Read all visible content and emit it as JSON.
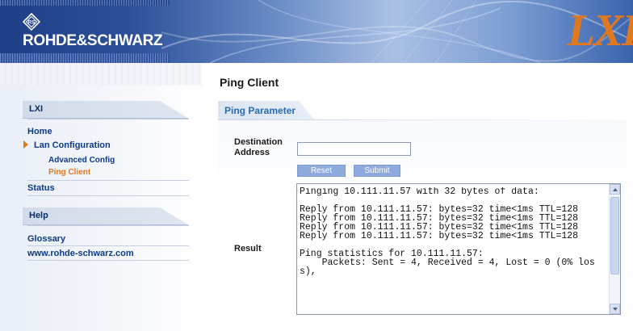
{
  "header": {
    "brand": "ROHDE&SCHWARZ",
    "brand_mark": "LXI",
    "accent_color": "#e07820",
    "banner_color": "#2a4f98"
  },
  "sidebar": {
    "sections": [
      {
        "title": "LXI",
        "items": [
          {
            "label": "Home",
            "level": 1,
            "active": false
          },
          {
            "label": "Lan Configuration",
            "level": 1,
            "active": false,
            "expanded": true
          },
          {
            "label": "Advanced Config",
            "level": 2,
            "active": false
          },
          {
            "label": "Ping Client",
            "level": 2,
            "active": true
          },
          {
            "label": "Status",
            "level": 1,
            "active": false
          }
        ]
      },
      {
        "title": "Help",
        "items": [
          {
            "label": "Glossary",
            "level": 1,
            "active": false
          },
          {
            "label": "www.rohde-schwarz.com",
            "level": 1,
            "active": false
          }
        ]
      }
    ]
  },
  "main": {
    "title": "Ping Client",
    "section_title": "Ping Parameter",
    "destination": {
      "label_line1": "Destination",
      "label_line2": "Address",
      "value": ""
    },
    "buttons": {
      "reset": "Reset",
      "submit": "Submit"
    },
    "result": {
      "label": "Result",
      "text": "Pinging 10.111.11.57 with 32 bytes of data:\n\nReply from 10.111.11.57: bytes=32 time<1ms TTL=128\nReply from 10.111.11.57: bytes=32 time<1ms TTL=128\nReply from 10.111.11.57: bytes=32 time<1ms TTL=128\nReply from 10.111.11.57: bytes=32 time<1ms TTL=128\n\nPing statistics for 10.111.11.57:\n    Packets: Sent = 4, Received = 4, Lost = 0 (0% loss),"
    }
  }
}
